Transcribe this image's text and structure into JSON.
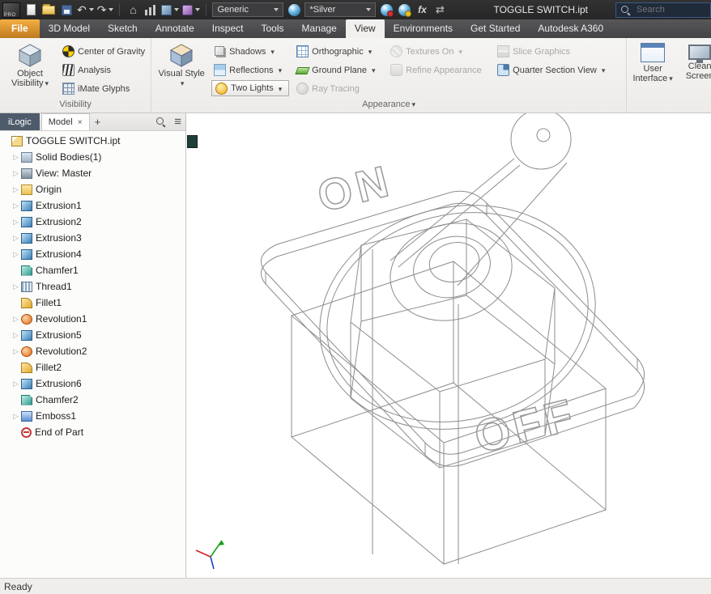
{
  "titlebar": {
    "app_badge": "PRO",
    "document_title": "TOGGLE SWITCH.ipt",
    "search_placeholder": "Search",
    "material_select": "Generic",
    "appearance_select": "*Silver",
    "fx_label": "fx"
  },
  "tabs": [
    {
      "label": "File",
      "kind": "file"
    },
    {
      "label": "3D Model",
      "kind": "normal"
    },
    {
      "label": "Sketch",
      "kind": "normal"
    },
    {
      "label": "Annotate",
      "kind": "normal"
    },
    {
      "label": "Inspect",
      "kind": "normal"
    },
    {
      "label": "Tools",
      "kind": "normal"
    },
    {
      "label": "Manage",
      "kind": "normal"
    },
    {
      "label": "View",
      "kind": "active"
    },
    {
      "label": "Environments",
      "kind": "normal"
    },
    {
      "label": "Get Started",
      "kind": "normal"
    },
    {
      "label": "Autodesk A360",
      "kind": "normal"
    }
  ],
  "ribbon": {
    "visibility": {
      "label": "Visibility",
      "big_button": "Object Visibility",
      "center_of_gravity": "Center of Gravity",
      "analysis": "Analysis",
      "imate_glyphs": "iMate Glyphs"
    },
    "appearance": {
      "label": "Appearance",
      "big_button": "Visual Style",
      "shadows": "Shadows",
      "reflections": "Reflections",
      "two_lights": "Two Lights",
      "orthographic": "Orthographic",
      "ground_plane": "Ground Plane",
      "ray_tracing": "Ray Tracing",
      "textures_on": "Textures On",
      "refine_appearance": "Refine Appearance",
      "slice_graphics": "Slice Graphics",
      "quarter_section_view": "Quarter Section View"
    },
    "windows": {
      "user_interface": "User Interface",
      "clean_screen": "Clean Screen"
    }
  },
  "browser": {
    "tabs": {
      "ilogic": "iLogic",
      "model": "Model",
      "close": "×",
      "add": "+"
    },
    "tree": [
      {
        "label": "TOGGLE SWITCH.ipt",
        "icon": "part",
        "arrow": false,
        "level": 0
      },
      {
        "label": "Solid Bodies(1)",
        "icon": "solid-bodies",
        "arrow": true,
        "level": 1
      },
      {
        "label": "View: Master",
        "icon": "view-master",
        "arrow": true,
        "level": 1
      },
      {
        "label": "Origin",
        "icon": "origin",
        "arrow": true,
        "level": 1
      },
      {
        "label": "Extrusion1",
        "icon": "extrusion",
        "arrow": true,
        "level": 1
      },
      {
        "label": "Extrusion2",
        "icon": "extrusion",
        "arrow": true,
        "level": 1
      },
      {
        "label": "Extrusion3",
        "icon": "extrusion",
        "arrow": true,
        "level": 1
      },
      {
        "label": "Extrusion4",
        "icon": "extrusion",
        "arrow": true,
        "level": 1
      },
      {
        "label": "Chamfer1",
        "icon": "chamfer",
        "arrow": false,
        "level": 1
      },
      {
        "label": "Thread1",
        "icon": "thread",
        "arrow": true,
        "level": 1
      },
      {
        "label": "Fillet1",
        "icon": "fillet",
        "arrow": false,
        "level": 1
      },
      {
        "label": "Revolution1",
        "icon": "revolution",
        "arrow": true,
        "level": 1
      },
      {
        "label": "Extrusion5",
        "icon": "extrusion",
        "arrow": true,
        "level": 1
      },
      {
        "label": "Revolution2",
        "icon": "revolution",
        "arrow": true,
        "level": 1
      },
      {
        "label": "Fillet2",
        "icon": "fillet",
        "arrow": false,
        "level": 1
      },
      {
        "label": "Extrusion6",
        "icon": "extrusion",
        "arrow": true,
        "level": 1
      },
      {
        "label": "Chamfer2",
        "icon": "chamfer",
        "arrow": false,
        "level": 1
      },
      {
        "label": "Emboss1",
        "icon": "emboss",
        "arrow": true,
        "level": 1
      },
      {
        "label": "End of Part",
        "icon": "end-of-part",
        "arrow": false,
        "level": 1
      }
    ]
  },
  "viewport": {
    "on_label": "ON",
    "off_label": "OFF"
  },
  "statusbar": {
    "text": "Ready"
  }
}
